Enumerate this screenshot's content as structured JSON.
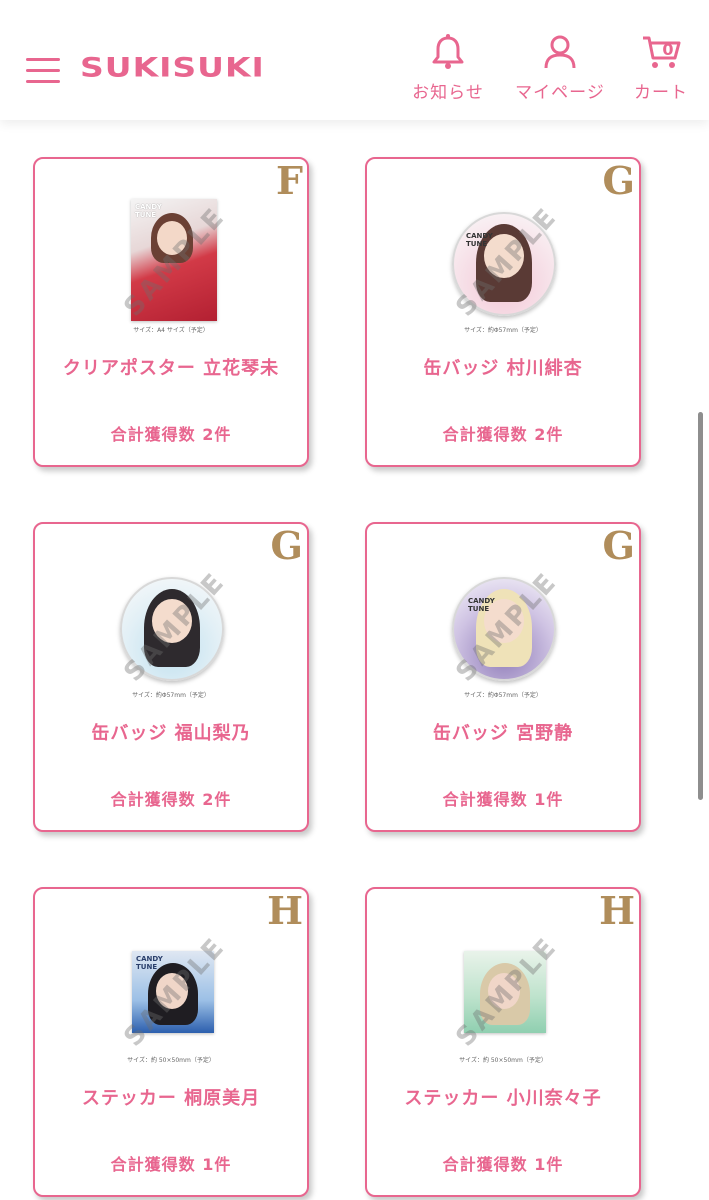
{
  "header": {
    "logo": "SUKISUKI",
    "nav": {
      "notifications": "お知らせ",
      "mypage": "マイページ",
      "cart": "カート",
      "cart_count": "0"
    }
  },
  "watermark": "SAMPLE",
  "items": [
    {
      "grade": "F",
      "title": "クリアポスター 立花琴未",
      "count": "合計獲得数 2件",
      "size_note": "サイズ：A4 サイズ（予定）",
      "type": "poster"
    },
    {
      "grade": "G",
      "title": "缶バッジ 村川緋杏",
      "count": "合計獲得数 2件",
      "size_note": "サイズ：約Φ57mm（予定）",
      "type": "badge"
    },
    {
      "grade": "G",
      "title": "缶バッジ 福山梨乃",
      "count": "合計獲得数 2件",
      "size_note": "サイズ：約Φ57mm（予定）",
      "type": "badge"
    },
    {
      "grade": "G",
      "title": "缶バッジ 宮野静",
      "count": "合計獲得数 1件",
      "size_note": "サイズ：約Φ57mm（予定）",
      "type": "badge"
    },
    {
      "grade": "H",
      "title": "ステッカー 桐原美月",
      "count": "合計獲得数 1件",
      "size_note": "サイズ：約 50×50mm（予定）",
      "type": "sticker"
    },
    {
      "grade": "H",
      "title": "ステッカー 小川奈々子",
      "count": "合計獲得数 1件",
      "size_note": "サイズ：約 50×50mm（予定）",
      "type": "sticker"
    }
  ],
  "colors": {
    "accent": "#e8668f",
    "grade_gold": "#b08d5b",
    "scrollbar": "#8e8e8e"
  }
}
